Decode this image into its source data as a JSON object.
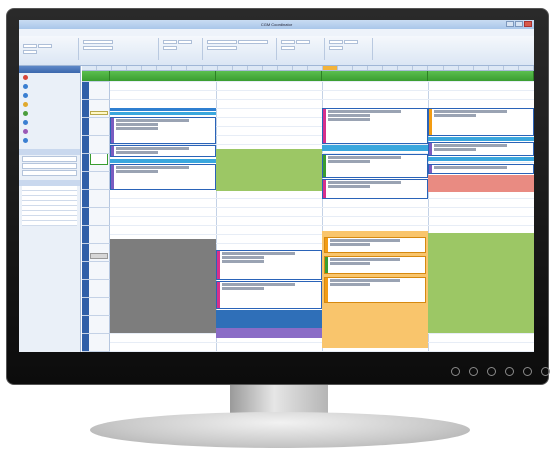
{
  "app": {
    "window_title": "CGM Coordinator"
  },
  "colors": {
    "day_header": "#3a9d30",
    "event_border": "#2a63b8",
    "green_block": "#9cc765",
    "grey_block": "#7d7d7d",
    "orange_block": "#f9c56c",
    "salmon_block": "#e98b82",
    "purple_bar": "#7a5cc0",
    "magenta_bar": "#d6308c",
    "timeline_blue": "#2f5fa8"
  },
  "icons": [
    "calendar-icon",
    "people-icon",
    "checklist-icon",
    "folder-icon",
    "search-icon",
    "close-icon",
    "minimize-icon",
    "maximize-icon"
  ]
}
